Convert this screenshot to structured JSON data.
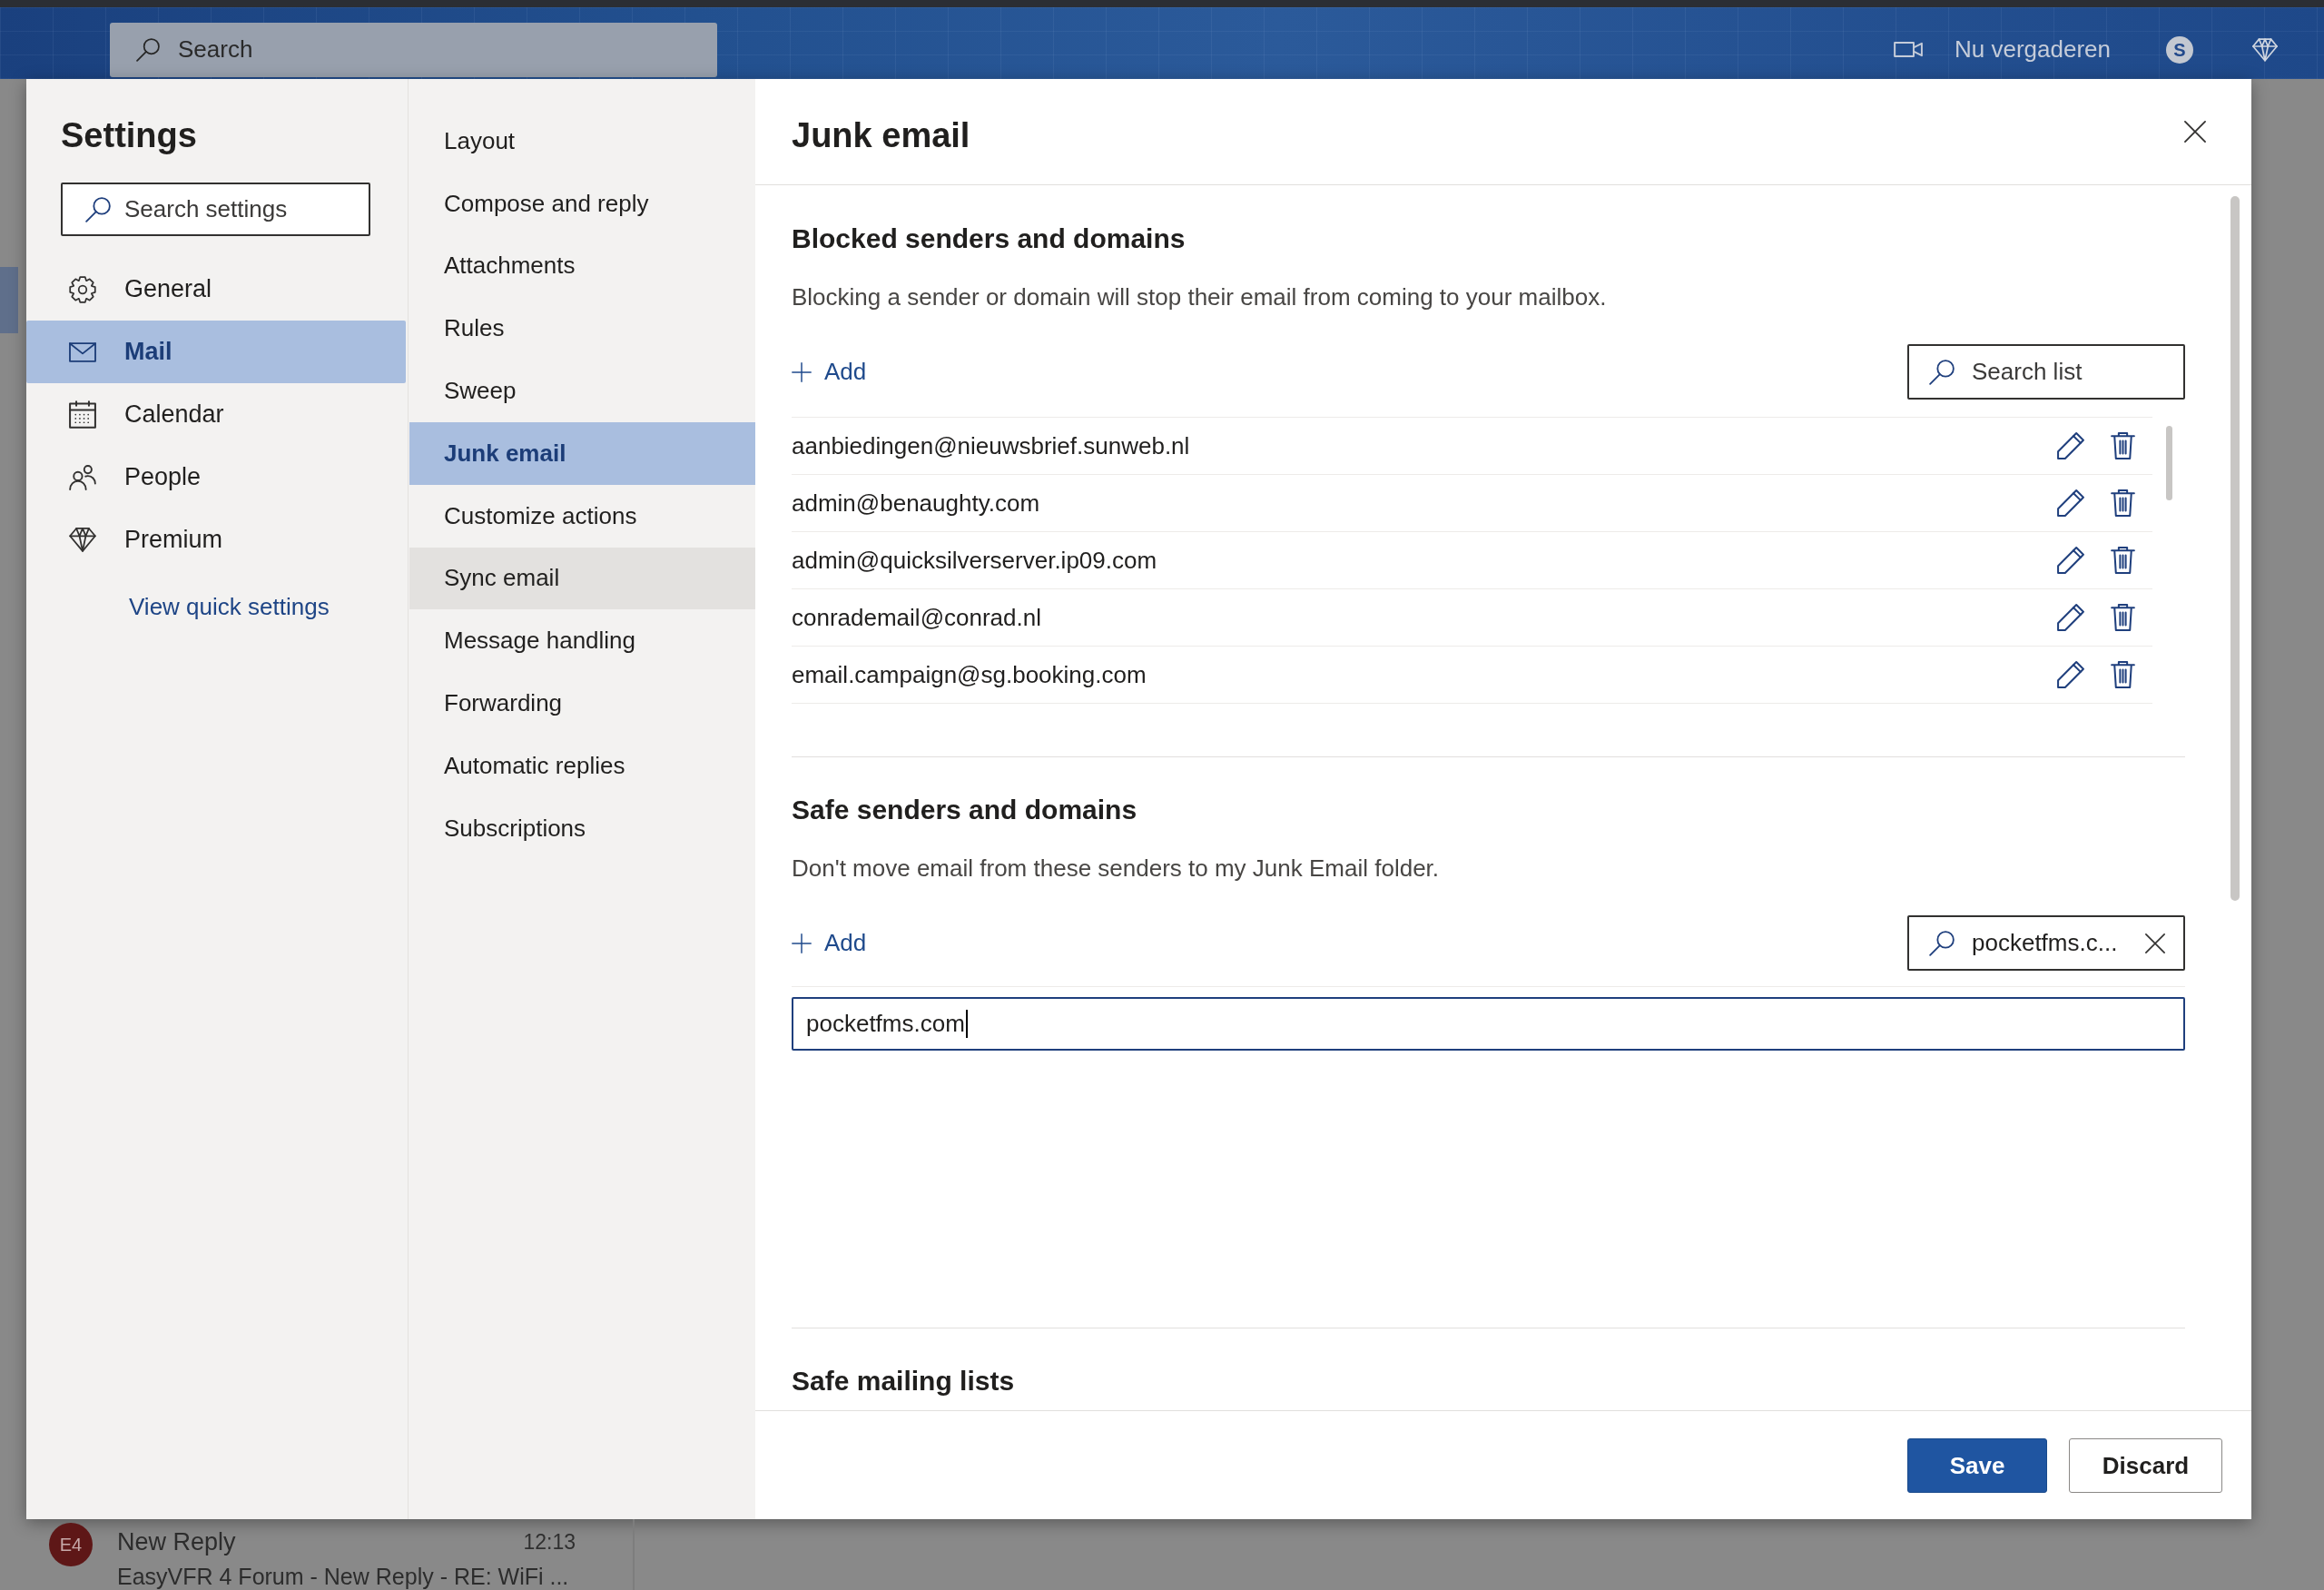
{
  "top_bar": {
    "search": {
      "placeholder": "Search"
    },
    "meet_now": "Nu vergaderen",
    "app_badge": "S"
  },
  "settings": {
    "title": "Settings",
    "search": {
      "placeholder": "Search settings"
    },
    "categories": [
      {
        "label": "General",
        "selected": false
      },
      {
        "label": "Mail",
        "selected": true
      },
      {
        "label": "Calendar",
        "selected": false
      },
      {
        "label": "People",
        "selected": false
      },
      {
        "label": "Premium",
        "selected": false
      }
    ],
    "quick_settings_link": "View quick settings",
    "subcategories": [
      {
        "label": "Layout",
        "selected": false,
        "hovered": false
      },
      {
        "label": "Compose and reply",
        "selected": false,
        "hovered": false
      },
      {
        "label": "Attachments",
        "selected": false,
        "hovered": false
      },
      {
        "label": "Rules",
        "selected": false,
        "hovered": false
      },
      {
        "label": "Sweep",
        "selected": false,
        "hovered": false
      },
      {
        "label": "Junk email",
        "selected": true,
        "hovered": false
      },
      {
        "label": "Customize actions",
        "selected": false,
        "hovered": false
      },
      {
        "label": "Sync email",
        "selected": false,
        "hovered": true
      },
      {
        "label": "Message handling",
        "selected": false,
        "hovered": false
      },
      {
        "label": "Forwarding",
        "selected": false,
        "hovered": false
      },
      {
        "label": "Automatic replies",
        "selected": false,
        "hovered": false
      },
      {
        "label": "Subscriptions",
        "selected": false,
        "hovered": false
      }
    ]
  },
  "junk_email": {
    "title": "Junk email",
    "sections": [
      {
        "kind": "sender_list",
        "heading": "Blocked senders and domains",
        "description": "Blocking a sender or domain will stop their email from coming to your mailbox.",
        "add_label": "Add",
        "search": {
          "placeholder": "Search list"
        },
        "entries": [
          "aanbiedingen@nieuwsbrief.sunweb.nl",
          "admin@benaughty.com",
          "admin@quicksilverserver.ip09.com",
          "conrademail@conrad.nl",
          "email.campaign@sg.booking.com"
        ]
      },
      {
        "kind": "sender_list",
        "heading": "Safe senders and domains",
        "description": "Don't move email from these senders to my Junk Email folder.",
        "add_label": "Add",
        "search": {
          "value": "pocketfms.c..."
        },
        "new_entry": {
          "value": "pocketfms.com",
          "focused": true
        }
      },
      {
        "kind": "heading",
        "heading": "Safe mailing lists"
      }
    ],
    "buttons": [
      {
        "label": "Save",
        "kind": "primary"
      },
      {
        "label": "Discard",
        "kind": "secondary"
      }
    ]
  },
  "background_app": {
    "message": {
      "avatar_initials": "E4",
      "title": "New Reply",
      "time": "12:13",
      "preview": "EasyVFR 4 Forum - New Reply - RE: WiFi ..."
    }
  }
}
